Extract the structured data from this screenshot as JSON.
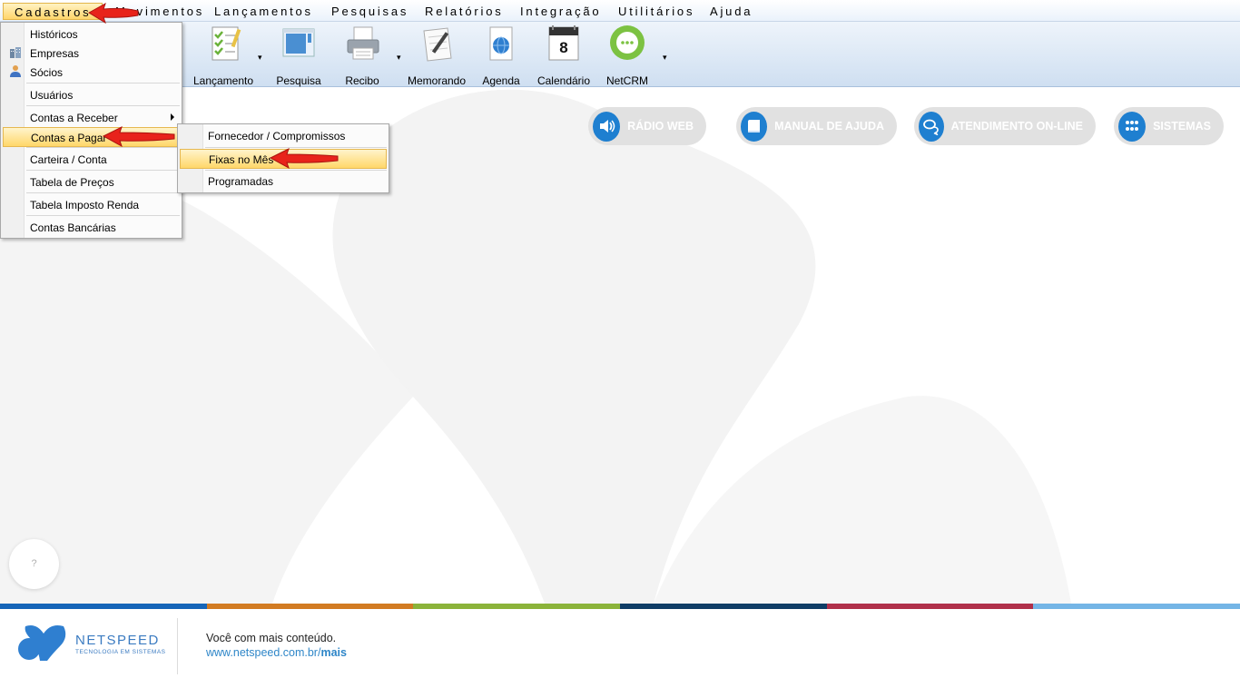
{
  "menubar": {
    "items": [
      "Cadastros",
      "Movimentos",
      "Lançamentos",
      "Pesquisas",
      "Relatórios",
      "Integração",
      "Utilitários",
      "Ajuda"
    ]
  },
  "toolbar": {
    "buttons": [
      {
        "label": "Lançamento",
        "icon": "checklist-icon"
      },
      {
        "label": "Pesquisa",
        "icon": "window-icon"
      },
      {
        "label": "Recibo",
        "icon": "printer-icon"
      },
      {
        "label": "Memorando",
        "icon": "memo-pen-icon"
      },
      {
        "label": "Agenda",
        "icon": "globe-agenda-icon"
      },
      {
        "label": "Calendário",
        "icon": "calendar-icon",
        "calendar_day": "8"
      },
      {
        "label": "NetCRM",
        "icon": "chat-bubble-icon"
      }
    ]
  },
  "quick_links": [
    {
      "label": "RÁDIO WEB",
      "icon": "speaker-icon"
    },
    {
      "label": "MANUAL DE AJUDA",
      "icon": "book-icon"
    },
    {
      "label": "ATENDIMENTO ON-LINE",
      "icon": "chat-icon"
    },
    {
      "label": "SISTEMAS",
      "icon": "grid-dots-icon"
    }
  ],
  "cadastros_menu": {
    "items": [
      {
        "label": "Históricos",
        "icon": ""
      },
      {
        "label": "Empresas",
        "icon": "buildings-icon"
      },
      {
        "label": "Sócios",
        "icon": "person-icon"
      },
      {
        "label": "Usuários",
        "icon": ""
      },
      {
        "label": "Contas a Receber",
        "icon": "",
        "submenu": true
      },
      {
        "label": "Contas a Pagar",
        "icon": "",
        "submenu": true,
        "highlighted": true
      },
      {
        "label": "Carteira / Conta",
        "icon": ""
      },
      {
        "label": "Tabela de Preços",
        "icon": ""
      },
      {
        "label": "Tabela Imposto Renda",
        "icon": ""
      },
      {
        "label": "Contas Bancárias",
        "icon": ""
      }
    ]
  },
  "contas_pagar_submenu": {
    "items": [
      {
        "label": "Fornecedor / Compromissos"
      },
      {
        "label": "Fixas no Mês",
        "highlighted": true
      },
      {
        "label": "Programadas"
      }
    ]
  },
  "help_button": {
    "label": "?"
  },
  "footer": {
    "brand": "NETSPEED",
    "brand_sub": "TECNOLOGIA EM SISTEMAS",
    "tagline": "Você com mais conteúdo.",
    "url_base": "www.netspeed.com.br/",
    "url_bold": "mais"
  },
  "colors": {
    "accent_blue": "#1e7fd0",
    "menu_highlight": "#ffd76a",
    "annotation_red": "#e8231b",
    "footer_bar": [
      "#1565b8",
      "#d27b22",
      "#8bb33a",
      "#0f3d66",
      "#b0304a",
      "#74b5e6"
    ]
  }
}
